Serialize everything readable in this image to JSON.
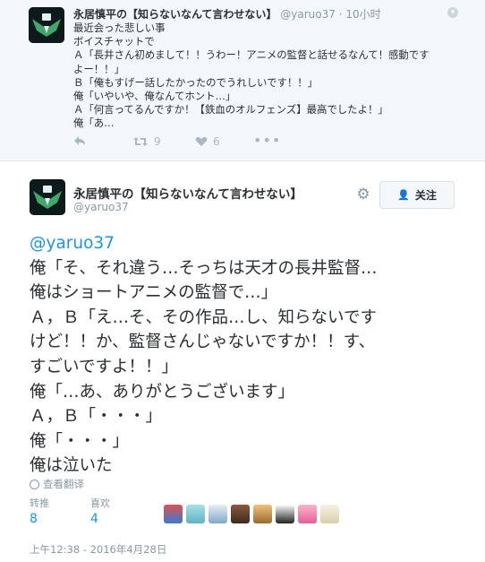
{
  "parent_tweet": {
    "name": "永居慎平の【知らないなんて言わせない】",
    "handle": "@yaruo37",
    "separator": "·",
    "time": "10小时",
    "lines": [
      "最近会った悲しい事",
      "ボイスチャットで",
      "Ａ「長井さん初めまして！！うわー！アニメの監督と話せるなんて！感動です",
      "よー！！」",
      "Ｂ「俺もすげー話したかったのでうれしいです！！」",
      "俺「いやいや、俺なんてホント…」",
      "Ａ「何言ってるんですか！【鉄血のオルフェンズ】最高でしたよ！」",
      "俺「あ…"
    ],
    "retweet_count": "9",
    "like_count": "6",
    "reply_icon": "reply-arrow",
    "retweet_icon": "retweet-arrows",
    "like_icon": "heart",
    "more_icon": "ellipsis"
  },
  "main_tweet": {
    "name": "永居慎平の【知らないなんて言わせない】",
    "handle": "@yaruo37",
    "follow_label": "关注",
    "settings_icon": "gear",
    "mention": "@yaruo37",
    "lines": [
      "俺「そ、それ違う…そっちは天才の長井監督…",
      "俺はショートアニメの監督で…」",
      "Ａ，Ｂ「え…そ、その作品…し、知らないです",
      "けど！！か、監督さんじゃないですか！！す、",
      "すごいですよ！！」",
      "俺「…あ、ありがとうございます」",
      "Ａ，Ｂ「・・・」",
      "俺「・・・」",
      "俺は泣いた"
    ],
    "translate_label": "查看翻译",
    "retweets_label": "转推",
    "retweets_count": "8",
    "likes_label": "喜欢",
    "likes_count": "4",
    "timestamp": "上午12:38 - 2016年4月28日"
  },
  "colors": {
    "link": "#1b95e0",
    "muted": "#8899a6",
    "text": "#292f33",
    "parent_bg": "#f5f8fa"
  }
}
